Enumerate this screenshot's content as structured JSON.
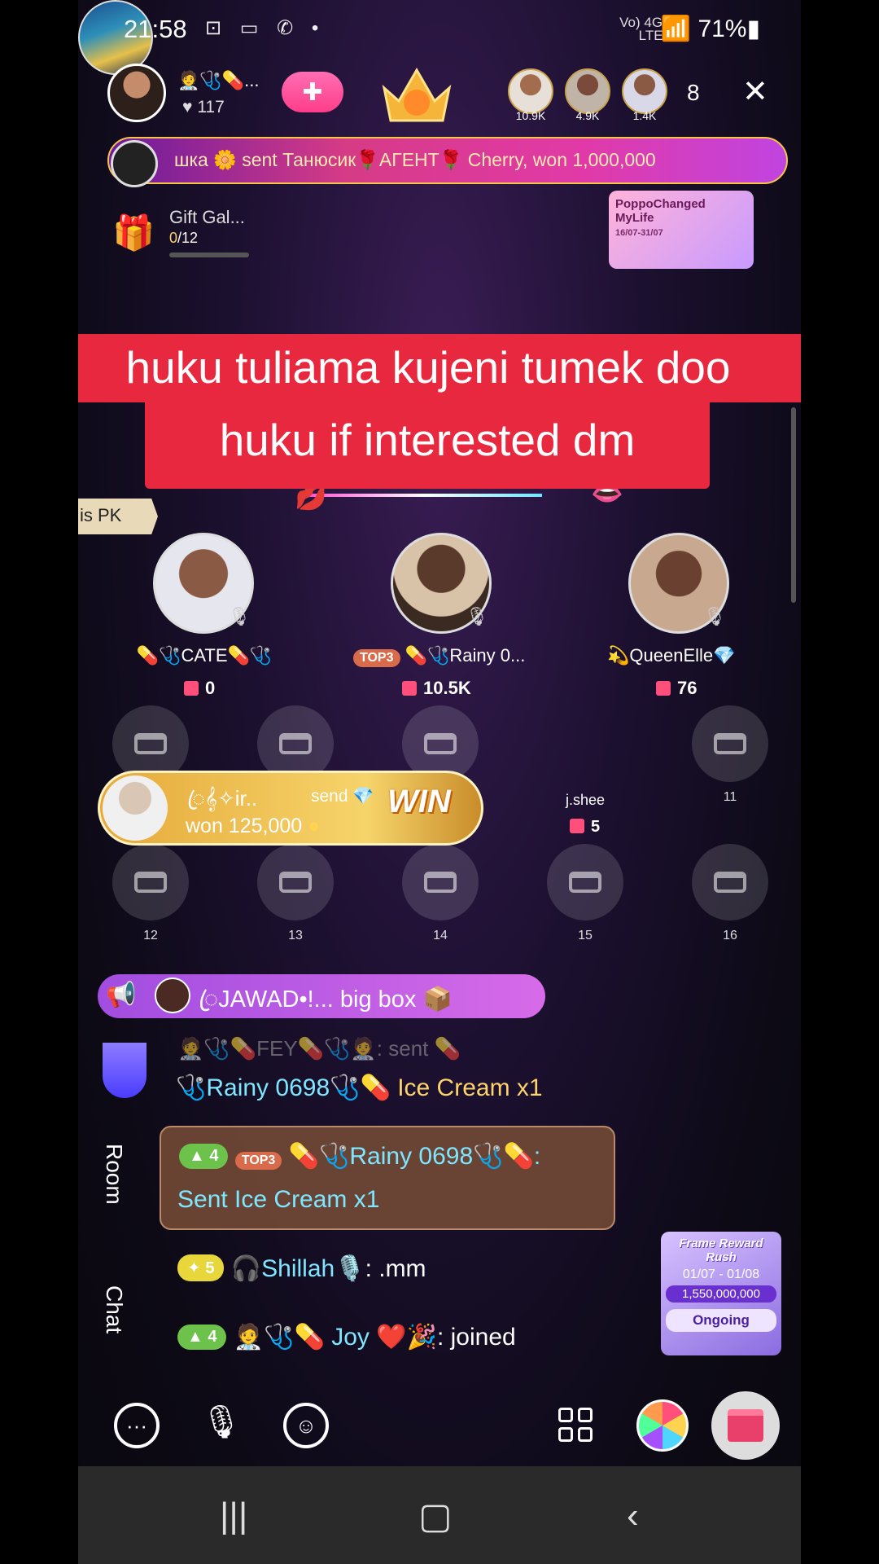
{
  "status_bar": {
    "time": "21:58",
    "battery": "71%",
    "net": "Vo) 4G+ LTE1"
  },
  "host": {
    "name": "🧑‍⚕️🩺💊...",
    "likes": "117",
    "follow_icon": "plus-heart-icon"
  },
  "top_viewers": [
    {
      "count": "10.9K"
    },
    {
      "count": "4.9K"
    },
    {
      "count": "1.4K"
    }
  ],
  "viewer_total": "8",
  "gift_banner": {
    "text": "шка 🌼 sent Танюсик🌹АГЕНТ🌹 Cherry, won 1,000,000"
  },
  "gift_gallery": {
    "title": "Gift Gal...",
    "progress": "0",
    "total": "/12"
  },
  "promo": {
    "title": "PoppoChanged MyLife",
    "dates": "16/07-31/07"
  },
  "caption": {
    "line1": "huku tuliama kujeni tumek doo",
    "line2": "huku if interested dm"
  },
  "pk_tag": "is PK",
  "seats": [
    {
      "name": "💊🩺CATE💊🩺",
      "gifts": "0"
    },
    {
      "name": "💊🩺Rainy 0...",
      "gifts": "10.5K",
      "badge": "TOP3"
    },
    {
      "name": "💫QueenElle💎",
      "gifts": "76"
    }
  ],
  "empty_seats_row1": [
    {
      "num": ""
    },
    {
      "num": ""
    },
    {
      "num": ""
    }
  ],
  "special_seat": {
    "name": "j.shee",
    "gifts": "5"
  },
  "seat_11": {
    "num": "11"
  },
  "empty_seats_row2": [
    {
      "num": "12"
    },
    {
      "num": "13"
    },
    {
      "num": "14"
    },
    {
      "num": "15"
    },
    {
      "num": "16"
    }
  ],
  "win_banner": {
    "name": "ꦿ𝄞✧ir..",
    "action": "send 💎",
    "won": "won 125,000",
    "tag": "WIN"
  },
  "broadcast": {
    "text": "ꦿJAWAD•!... big box 📦"
  },
  "chat_tabs": {
    "room": "Room",
    "chat": "Chat"
  },
  "messages": {
    "faded": "🧑‍⚕️🩺💊FEY💊🩺🧑‍⚕️: sent 💊",
    "first": {
      "name": "🩺Rainy 0698🩺💊",
      "gift": "Ice Cream x1"
    },
    "gifted": {
      "level": "4",
      "badge": "TOP3",
      "name": "💊🩺Rainy 0698🩺💊:",
      "text": "Sent Ice Cream x1"
    },
    "third": {
      "level": "5",
      "name": "🎧Shillah🎙️",
      "text": ": .mm"
    },
    "fourth": {
      "level": "4",
      "name": "🧑‍⚕️🩺💊 Joy ❤️🎉",
      "text": ": joined"
    }
  },
  "frame_reward": {
    "title": "Frame Reward Rush",
    "dates": "01/07 - 01/08",
    "value": "1,550,000,000",
    "status": "Ongoing"
  },
  "colors": {
    "caption_red": "#e8283e",
    "chat_cyan": "#7fe6ff",
    "gift_gold": "#ffd36b"
  }
}
